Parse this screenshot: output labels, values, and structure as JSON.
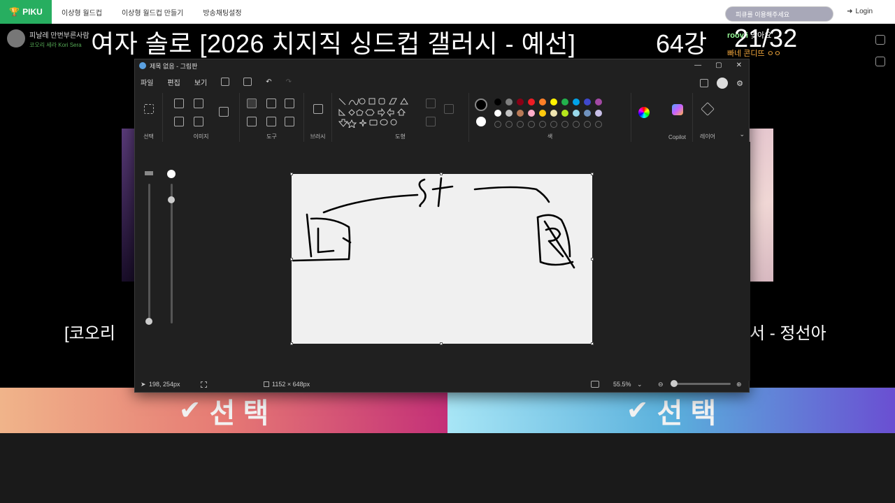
{
  "nav": {
    "logo": "PIKU",
    "items": [
      "이상형 월드컵",
      "이상형 월드컵 만들기",
      "방송채팅설정"
    ],
    "search_placeholder": "피큐를 이용해주세요",
    "login": "Login"
  },
  "stage": {
    "title": "여자 솔로 [2026 치지직 싱드컵 갤러시 - 예선]",
    "round": "64강",
    "score": "21/32",
    "left_candidate": {
      "name": "피날레 만번부른사람",
      "sub": "코오리 세라 Kori Sera"
    },
    "chat": {
      "user": "roovii",
      "message": "맞아요",
      "line2": "빠네 콘디뜨 ㅇㅇ"
    },
    "left_name": "[코오리 ",
    "right_name": "서 - 정선아",
    "select_label": "선 택"
  },
  "paint": {
    "window_title": "제목 없음 - 그림판",
    "menus": [
      "파일",
      "편집",
      "보기"
    ],
    "groups": {
      "select": "선택",
      "image": "이미지",
      "tools": "도구",
      "brush": "브러시",
      "shapes": "도형",
      "color": "색",
      "copilot": "Copilot",
      "layers": "레이어"
    },
    "colors": {
      "row1": [
        "#000000",
        "#7f7f7f",
        "#880015",
        "#ed1c24",
        "#ff7f27",
        "#fff200",
        "#22b14c",
        "#00a2e8",
        "#3f48cc",
        "#a349a4"
      ],
      "row2": [
        "#ffffff",
        "#c3c3c3",
        "#b97a57",
        "#ffaec9",
        "#ffc90e",
        "#efe4b0",
        "#b5e61d",
        "#99d9ea",
        "#7092be",
        "#c8bfe7"
      ]
    },
    "status": {
      "cursor": "198, 254px",
      "size": "1152 × 648px",
      "zoom": "55.5%"
    }
  }
}
